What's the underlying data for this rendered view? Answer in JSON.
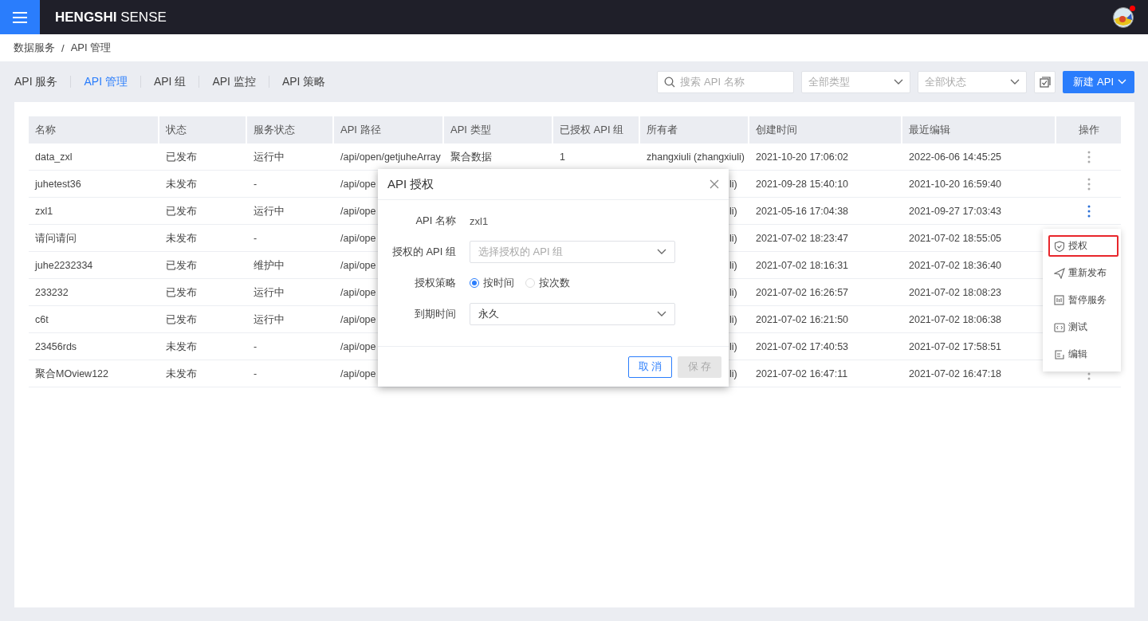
{
  "app": {
    "brand_bold": "HENGSHI",
    "brand_light": "SENSE",
    "has_notification": true
  },
  "breadcrumb": [
    "数据服务",
    "API 管理"
  ],
  "breadcrumb_separator": "/",
  "tabs": [
    {
      "label": "API 服务",
      "selected": false
    },
    {
      "label": "API 管理",
      "selected": true
    },
    {
      "label": "API 组",
      "selected": false
    },
    {
      "label": "API 监控",
      "selected": false
    },
    {
      "label": "API 策略",
      "selected": false
    }
  ],
  "toolbar": {
    "search": {
      "placeholder": "搜索 API 名称"
    },
    "filters": [
      {
        "placeholder": "全部类型"
      },
      {
        "placeholder": "全部状态"
      }
    ],
    "create_button": "新建 API"
  },
  "table": {
    "columns": [
      "名称",
      "状态",
      "服务状态",
      "API 路径",
      "API 类型",
      "已授权 API 组",
      "所有者",
      "创建时间",
      "最近编辑",
      "操作"
    ],
    "rows": [
      {
        "name": "data_zxl",
        "status": "已发布",
        "service_status": "运行中",
        "path": "/api/open/getjuheArray",
        "type": "聚合数据",
        "groups": "1",
        "owner": "zhangxiuli (zhangxiuli)",
        "owner_cut": false,
        "created": "2021-10-20 17:06:02",
        "edited": "2022-06-06 14:45:25",
        "more_active": false
      },
      {
        "name": "juhetest36",
        "status": "未发布",
        "service_status": "-",
        "path": "/api/ope",
        "owner": "li)",
        "owner_cut": true,
        "created": "2021-09-28 15:40:10",
        "edited": "2021-10-20 16:59:40",
        "more_active": false
      },
      {
        "name": "zxl1",
        "status": "已发布",
        "service_status": "运行中",
        "path": "/api/ope",
        "owner": "li)",
        "owner_cut": true,
        "created": "2021-05-16 17:04:38",
        "edited": "2021-09-27 17:03:43",
        "more_active": true
      },
      {
        "name": "请问请问",
        "status": "未发布",
        "service_status": "-",
        "path": "/api/ope",
        "owner": "li)",
        "owner_cut": true,
        "created": "2021-07-02 18:23:47",
        "edited": "2021-07-02 18:55:05"
      },
      {
        "name": "juhe2232334",
        "status": "已发布",
        "service_status": "维护中",
        "path": "/api/ope",
        "owner": "li)",
        "owner_cut": true,
        "created": "2021-07-02 18:16:31",
        "edited": "2021-07-02 18:36:40"
      },
      {
        "name": "233232",
        "status": "已发布",
        "service_status": "运行中",
        "path": "/api/ope",
        "owner": "li)",
        "owner_cut": true,
        "created": "2021-07-02 16:26:57",
        "edited": "2021-07-02 18:08:23"
      },
      {
        "name": "c6t",
        "status": "已发布",
        "service_status": "运行中",
        "path": "/api/ope",
        "owner": "li)",
        "owner_cut": true,
        "created": "2021-07-02 16:21:50",
        "edited": "2021-07-02 18:06:38"
      },
      {
        "name": "23456rds",
        "status": "未发布",
        "service_status": "-",
        "path": "/api/ope",
        "owner": "li)",
        "owner_cut": true,
        "created": "2021-07-02 17:40:53",
        "edited": "2021-07-02 17:58:51"
      },
      {
        "name": "聚合MOview122",
        "status": "未发布",
        "service_status": "-",
        "path": "/api/ope",
        "owner": "li)",
        "owner_cut": true,
        "created": "2021-07-02 16:47:11",
        "edited": "2021-07-02 16:47:18",
        "more_active": false
      }
    ]
  },
  "action_menu": [
    {
      "label": "授权",
      "kind": "shield",
      "selected": true
    },
    {
      "label": "重新发布",
      "kind": "send",
      "selected": false
    },
    {
      "label": "暂停服务",
      "kind": "pause",
      "selected": false
    },
    {
      "label": "测试",
      "kind": "code",
      "selected": false
    },
    {
      "label": "编辑",
      "kind": "edit",
      "selected": false
    }
  ],
  "dialog": {
    "title": "API 授权",
    "name_label": "API 名称",
    "name_value": "zxl1",
    "group_label": "授权的 API 组",
    "group_placeholder": "选择授权的 API 组",
    "strategy_label": "授权策略",
    "strategy_options": [
      {
        "label": "按时间",
        "selected": true
      },
      {
        "label": "按次数",
        "selected": false
      }
    ],
    "expiry_label": "到期时间",
    "expiry_value": "永久",
    "cancel_button": "取 消",
    "save_button": "保 存",
    "save_disabled": true
  }
}
